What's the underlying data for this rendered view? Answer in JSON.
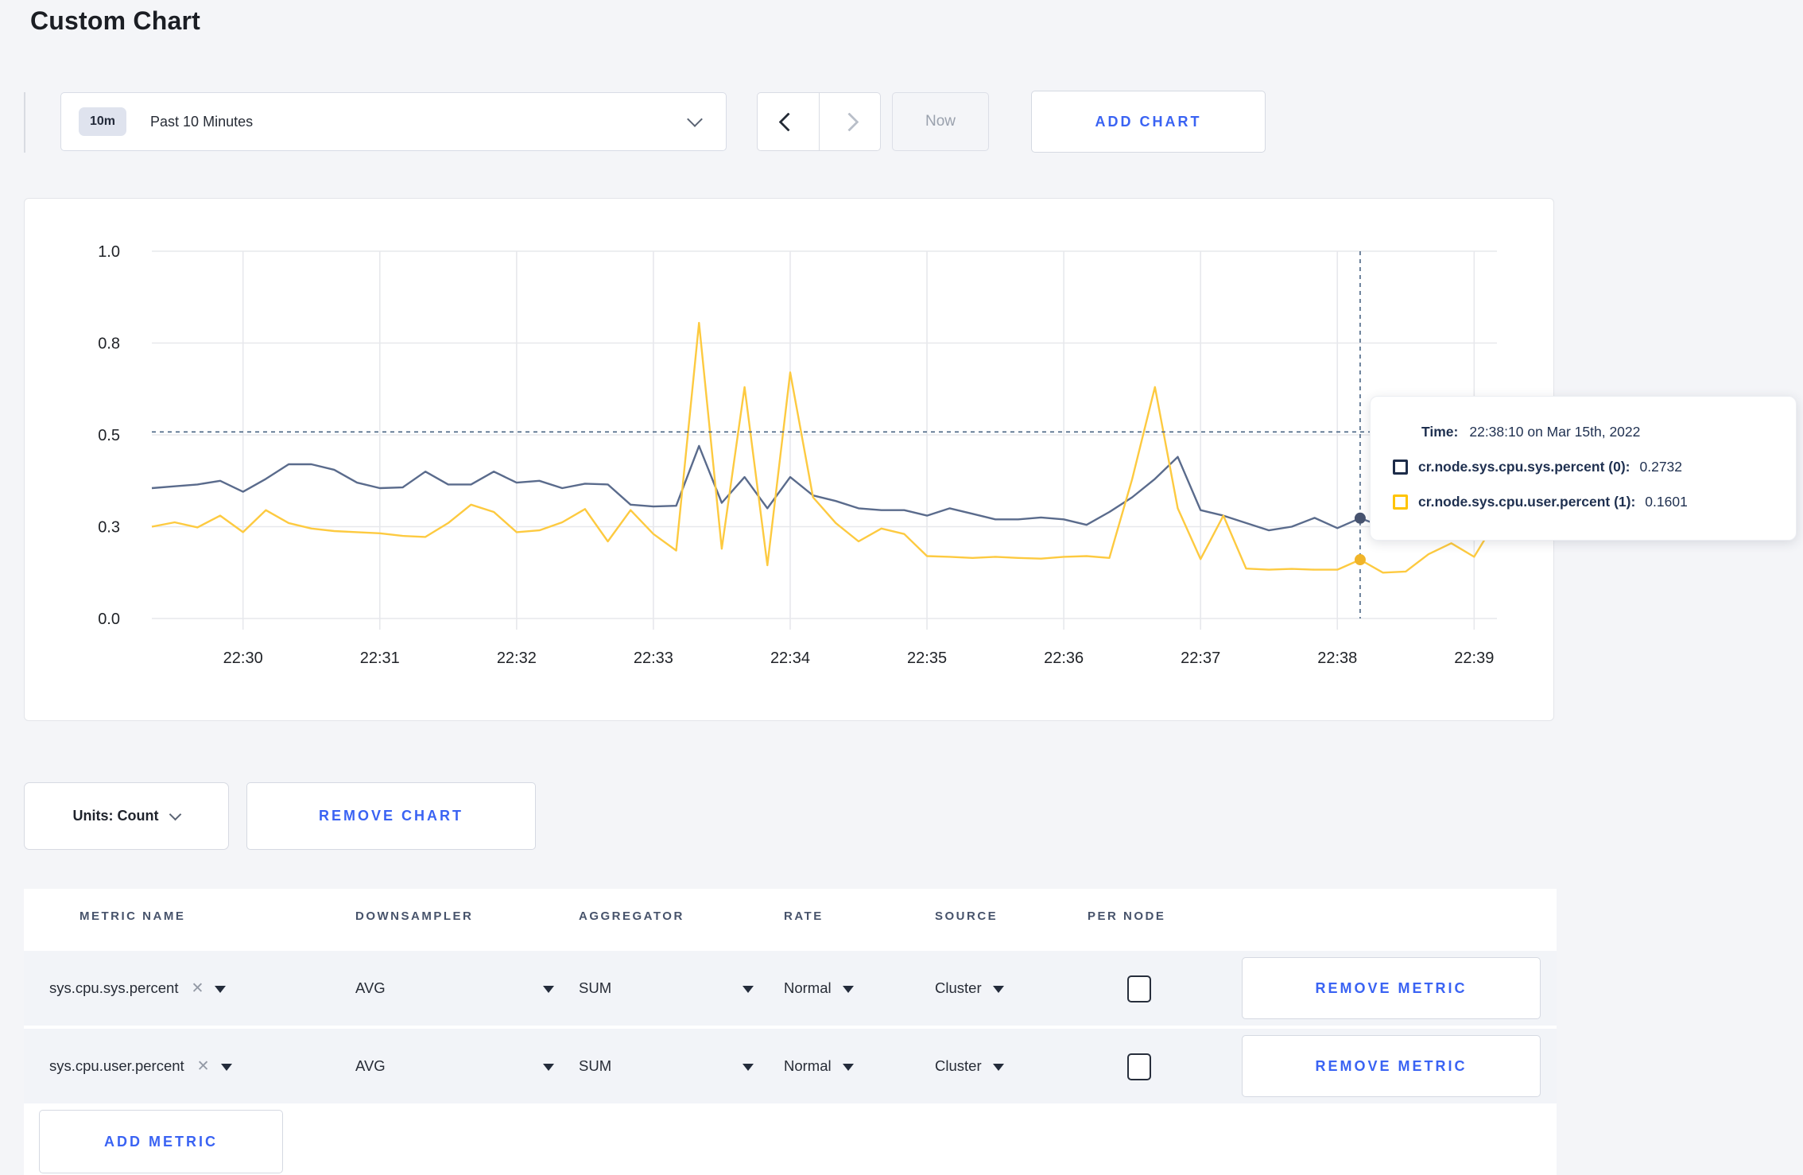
{
  "page": {
    "title": "Custom Chart"
  },
  "toolbar": {
    "time_selector": {
      "badge": "10m",
      "label": "Past 10 Minutes"
    },
    "now_label": "Now",
    "add_chart_label": "ADD CHART"
  },
  "colors": {
    "accent_blue": "#3a63f3",
    "series_sys": "#5a6b8c",
    "series_sys_dot": "#47536f",
    "series_sys_swatch": "#1d2c49",
    "series_user": "#fdca40",
    "series_user_dot": "#f0b429",
    "series_user_swatch": "#ffc400",
    "grid": "#e7e8ec",
    "crosshair": "#4a6584"
  },
  "chart_data": {
    "type": "line",
    "title": "",
    "xlabel": "",
    "ylabel": "",
    "ylim": [
      0,
      1
    ],
    "grid": true,
    "legend_position": "hover-tooltip",
    "y_ticks": [
      {
        "label": "0.0",
        "value": 0
      },
      {
        "label": "0.3",
        "value": 0.25
      },
      {
        "label": "0.5",
        "value": 0.5
      },
      {
        "label": "0.8",
        "value": 0.75
      },
      {
        "label": "1.0",
        "value": 1
      }
    ],
    "x_ticks": [
      {
        "label": "22:30",
        "index": 4
      },
      {
        "label": "22:31",
        "index": 10
      },
      {
        "label": "22:32",
        "index": 16
      },
      {
        "label": "22:33",
        "index": 22
      },
      {
        "label": "22:34",
        "index": 28
      },
      {
        "label": "22:35",
        "index": 34
      },
      {
        "label": "22:36",
        "index": 40
      },
      {
        "label": "22:37",
        "index": 46
      },
      {
        "label": "22:38",
        "index": 52
      },
      {
        "label": "22:39",
        "index": 58
      }
    ],
    "times": [
      "22:29:20",
      "22:29:30",
      "22:29:40",
      "22:29:50",
      "22:30:00",
      "22:30:10",
      "22:30:20",
      "22:30:30",
      "22:30:40",
      "22:30:50",
      "22:31:00",
      "22:31:10",
      "22:31:20",
      "22:31:30",
      "22:31:40",
      "22:31:50",
      "22:32:00",
      "22:32:10",
      "22:32:20",
      "22:32:30",
      "22:32:40",
      "22:32:50",
      "22:33:00",
      "22:33:10",
      "22:33:20",
      "22:33:30",
      "22:33:40",
      "22:33:50",
      "22:34:00",
      "22:34:10",
      "22:34:20",
      "22:34:30",
      "22:34:40",
      "22:34:50",
      "22:35:00",
      "22:35:10",
      "22:35:20",
      "22:35:30",
      "22:35:40",
      "22:35:50",
      "22:36:00",
      "22:36:10",
      "22:36:20",
      "22:36:30",
      "22:36:40",
      "22:36:50",
      "22:37:00",
      "22:37:10",
      "22:37:20",
      "22:37:30",
      "22:37:40",
      "22:37:50",
      "22:38:00",
      "22:38:10",
      "22:38:20",
      "22:38:30",
      "22:38:40",
      "22:38:50",
      "22:39:00",
      "22:39:10"
    ],
    "series": [
      {
        "name": "cr.node.sys.cpu.sys.percent (0)",
        "color_key": "series_sys",
        "values": [
          0.355,
          0.36,
          0.365,
          0.375,
          0.345,
          0.38,
          0.42,
          0.42,
          0.405,
          0.37,
          0.355,
          0.357,
          0.4,
          0.365,
          0.365,
          0.4,
          0.37,
          0.375,
          0.355,
          0.367,
          0.365,
          0.31,
          0.305,
          0.307,
          0.47,
          0.315,
          0.385,
          0.3,
          0.385,
          0.335,
          0.32,
          0.3,
          0.295,
          0.295,
          0.28,
          0.3,
          0.285,
          0.27,
          0.27,
          0.275,
          0.27,
          0.255,
          0.29,
          0.33,
          0.38,
          0.44,
          0.295,
          0.28,
          0.26,
          0.24,
          0.25,
          0.274,
          0.246,
          0.2732,
          0.25,
          0.26,
          0.255,
          0.27,
          0.3,
          0.305
        ]
      },
      {
        "name": "cr.node.sys.cpu.user.percent (1)",
        "color_key": "series_user",
        "values": [
          0.25,
          0.262,
          0.248,
          0.28,
          0.235,
          0.295,
          0.26,
          0.245,
          0.238,
          0.235,
          0.232,
          0.225,
          0.222,
          0.26,
          0.31,
          0.29,
          0.235,
          0.24,
          0.262,
          0.298,
          0.21,
          0.295,
          0.23,
          0.185,
          0.805,
          0.19,
          0.63,
          0.145,
          0.67,
          0.33,
          0.26,
          0.21,
          0.245,
          0.23,
          0.17,
          0.168,
          0.165,
          0.168,
          0.165,
          0.163,
          0.168,
          0.17,
          0.165,
          0.38,
          0.63,
          0.3,
          0.162,
          0.28,
          0.136,
          0.133,
          0.135,
          0.133,
          0.133,
          0.1601,
          0.125,
          0.128,
          0.175,
          0.205,
          0.168,
          0.27
        ]
      }
    ],
    "crosshair": {
      "index": 53,
      "time": "22:38:10",
      "y_value": 0.508
    }
  },
  "tooltip": {
    "time_label": "Time:",
    "time_value": "22:38:10 on Mar 15th, 2022",
    "rows": [
      {
        "label": "cr.node.sys.cpu.sys.percent (0):",
        "value": "0.2732",
        "color": "#1d2c49"
      },
      {
        "label": "cr.node.sys.cpu.user.percent (1):",
        "value": "0.1601",
        "color": "#ffc400"
      }
    ]
  },
  "units_bar": {
    "units_label": "Units: Count",
    "remove_chart_label": "REMOVE CHART"
  },
  "metrics_table": {
    "headers": {
      "metric_name": "METRIC NAME",
      "downsampler": "DOWNSAMPLER",
      "aggregator": "AGGREGATOR",
      "rate": "RATE",
      "source": "SOURCE",
      "per_node": "PER NODE"
    },
    "rows": [
      {
        "metric": "sys.cpu.sys.percent",
        "clear": "✕",
        "downsampler": "AVG",
        "aggregator": "SUM",
        "rate": "Normal",
        "source": "Cluster",
        "per_node_checked": false,
        "remove_label": "REMOVE METRIC"
      },
      {
        "metric": "sys.cpu.user.percent",
        "clear": "✕",
        "downsampler": "AVG",
        "aggregator": "SUM",
        "rate": "Normal",
        "source": "Cluster",
        "per_node_checked": false,
        "remove_label": "REMOVE METRIC"
      }
    ],
    "add_metric_label": "ADD METRIC"
  }
}
